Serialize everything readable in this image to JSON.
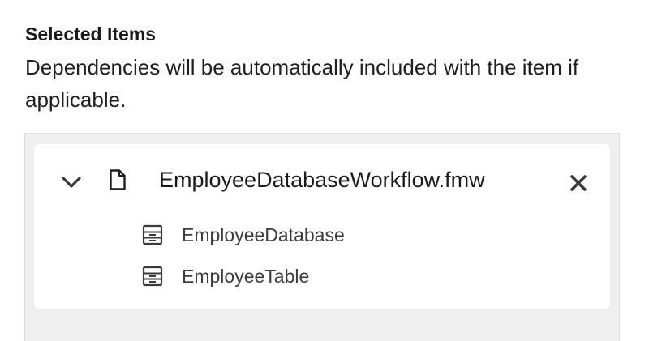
{
  "section": {
    "title": "Selected Items",
    "description": "Dependencies will be automatically included with the item if applicable."
  },
  "selected_item": {
    "name": "EmployeeDatabaseWorkflow.fmw",
    "expanded": true,
    "icons": {
      "toggle": "chevron-down-icon",
      "type": "file-icon",
      "remove": "close-icon"
    },
    "dependencies": [
      {
        "name": "EmployeeDatabase",
        "icon": "table-icon"
      },
      {
        "name": "EmployeeTable",
        "icon": "table-icon"
      }
    ]
  },
  "colors": {
    "panel_background": "#efefef",
    "card_background": "#ffffff",
    "text_primary": "#1a1a1a",
    "text_secondary": "#3c3c3c",
    "icon": "#3a3a3a"
  }
}
